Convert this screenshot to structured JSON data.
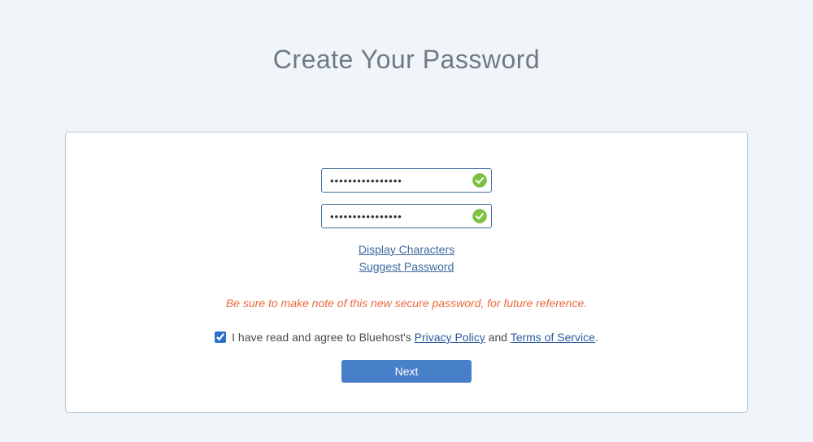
{
  "title": "Create Your Password",
  "password_field": {
    "value": "••••••••••••••••"
  },
  "confirm_field": {
    "value": "••••••••••••••••"
  },
  "links": {
    "display_characters": "Display Characters",
    "suggest_password": "Suggest Password"
  },
  "warning": "Be sure to make note of this new secure password, for future reference.",
  "agree": {
    "checked": true,
    "prefix": "I have read and agree to Bluehost's ",
    "privacy_link": "Privacy Policy",
    "middle": " and ",
    "terms_link": "Terms of Service",
    "suffix": "."
  },
  "next_button": "Next",
  "colors": {
    "page_bg": "#f0f5f9",
    "card_border": "#b8c8dc",
    "input_border": "#436fa0",
    "link": "#3c6a9e",
    "warning": "#e96a3b",
    "button": "#477fc8",
    "check_green": "#7dc242"
  }
}
